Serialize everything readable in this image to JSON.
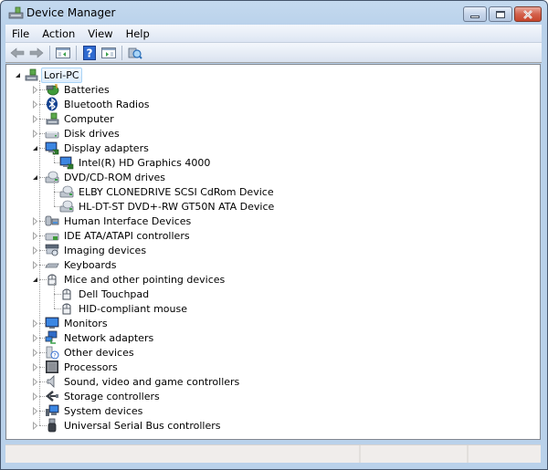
{
  "window": {
    "title": "Device Manager",
    "icon": "device-manager-icon",
    "caption_buttons": [
      "minimize",
      "maximize",
      "close"
    ]
  },
  "menu": [
    "File",
    "Action",
    "View",
    "Help"
  ],
  "toolbar": {
    "buttons": [
      {
        "name": "back-button",
        "icon": "arrow-left-icon"
      },
      {
        "name": "forward-button",
        "icon": "arrow-right-icon"
      },
      {
        "name": "show-hide-console-tree-button",
        "icon": "console-tree-icon"
      },
      {
        "name": "help-button",
        "icon": "help-icon"
      },
      {
        "name": "show-hide-action-pane-button",
        "icon": "action-pane-icon"
      },
      {
        "name": "scan-hardware-button",
        "icon": "scan-hardware-icon"
      }
    ]
  },
  "tree": {
    "root": {
      "label": "Lori-PC",
      "icon": "computer-icon",
      "expanded": true,
      "selected": true
    },
    "items": [
      {
        "label": "Batteries",
        "icon": "battery-icon",
        "expanded": false,
        "children": []
      },
      {
        "label": "Bluetooth Radios",
        "icon": "bluetooth-icon",
        "expanded": false,
        "children": []
      },
      {
        "label": "Computer",
        "icon": "computer-icon",
        "expanded": false,
        "children": []
      },
      {
        "label": "Disk drives",
        "icon": "disk-drive-icon",
        "expanded": false,
        "children": []
      },
      {
        "label": "Display adapters",
        "icon": "display-adapter-icon",
        "expanded": true,
        "children": [
          {
            "label": "Intel(R) HD Graphics 4000",
            "icon": "display-adapter-icon"
          }
        ]
      },
      {
        "label": "DVD/CD-ROM drives",
        "icon": "dvd-drive-icon",
        "expanded": true,
        "children": [
          {
            "label": "ELBY CLONEDRIVE SCSI CdRom Device",
            "icon": "dvd-drive-icon"
          },
          {
            "label": "HL-DT-ST DVD+-RW GT50N ATA Device",
            "icon": "dvd-drive-icon"
          }
        ]
      },
      {
        "label": "Human Interface Devices",
        "icon": "hid-icon",
        "expanded": false,
        "children": []
      },
      {
        "label": "IDE ATA/ATAPI controllers",
        "icon": "ide-controller-icon",
        "expanded": false,
        "children": []
      },
      {
        "label": "Imaging devices",
        "icon": "imaging-device-icon",
        "expanded": false,
        "children": []
      },
      {
        "label": "Keyboards",
        "icon": "keyboard-icon",
        "expanded": false,
        "children": []
      },
      {
        "label": "Mice and other pointing devices",
        "icon": "mouse-icon",
        "expanded": true,
        "children": [
          {
            "label": "Dell Touchpad",
            "icon": "mouse-icon"
          },
          {
            "label": "HID-compliant mouse",
            "icon": "mouse-icon"
          }
        ]
      },
      {
        "label": "Monitors",
        "icon": "monitor-icon",
        "expanded": false,
        "children": []
      },
      {
        "label": "Network adapters",
        "icon": "network-adapter-icon",
        "expanded": false,
        "children": []
      },
      {
        "label": "Other devices",
        "icon": "unknown-device-icon",
        "expanded": false,
        "children": []
      },
      {
        "label": "Processors",
        "icon": "processor-icon",
        "expanded": false,
        "children": []
      },
      {
        "label": "Sound, video and game controllers",
        "icon": "speaker-icon",
        "expanded": false,
        "children": []
      },
      {
        "label": "Storage controllers",
        "icon": "storage-controller-icon",
        "expanded": false,
        "children": []
      },
      {
        "label": "System devices",
        "icon": "system-device-icon",
        "expanded": false,
        "children": []
      },
      {
        "label": "Universal Serial Bus controllers",
        "icon": "usb-icon",
        "expanded": false,
        "children": []
      }
    ]
  },
  "statusbar": {
    "panes": [
      "",
      "",
      ""
    ]
  }
}
